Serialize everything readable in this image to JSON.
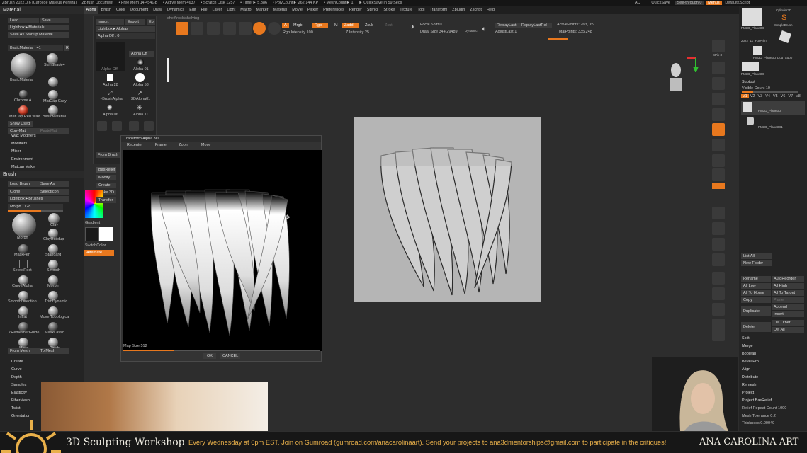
{
  "titlebar": {
    "items": [
      "ZBrush 2022.0.6 [Carol de Mateus Pereira]",
      "ZBrush Document",
      "• Free Mem 14.454GB",
      "• Active Mem 4637",
      "• Scratch Disk 1257",
      "• Timer► 5.386",
      "• PolyCount► 262.144 KP",
      "• MeshCount► 1",
      "► QuickSave In 59 Secs"
    ],
    "right": [
      "AC",
      "QuickSave",
      "See-through  0",
      "Menus",
      "DefaultZScript"
    ]
  },
  "menubar": [
    "Alpha",
    "Brush",
    "Color",
    "Document",
    "Draw",
    "Dynamics",
    "Edit",
    "File",
    "Layer",
    "Light",
    "Macro",
    "Marker",
    "Material",
    "Movie",
    "Picker",
    "Preferences",
    "Render",
    "Stencil",
    "Stroke",
    "Texture",
    "Tool",
    "Transform",
    "Zplugin",
    "Zscript",
    "Help"
  ],
  "left": {
    "material_title": "Material",
    "load": "Load",
    "save": "Save",
    "lightbox_materials": "Lightbox►Materials",
    "save_startup": "Save As Startup Material",
    "basic_material": "BasicMaterial . 41",
    "r": "R",
    "materials": [
      "BasicMaterial",
      "SkinShade4",
      "Chrome A",
      "MatCap Gray",
      "MatCap Red Wax",
      "BasicMaterial"
    ],
    "show_used": "Show Used",
    "copy_mat": "CopyMat",
    "paste_mat": "PasteMat",
    "sections": [
      "Wax Modifiers",
      "Modifiers",
      "Mixer",
      "Environment",
      "Matcap Maker"
    ],
    "brush_title": "Brush",
    "load_brush": "Load Brush",
    "save_as": "Save As",
    "clone": "Clone",
    "select_icon": "SelectIcon",
    "lightbox_brushes": "Lightbox►Brushes",
    "morph": "Morph . 128",
    "brushes": [
      "Morph",
      "Clay",
      "ClayBuildup",
      "MaskPen",
      "Standard",
      "SelectRect",
      "Smooth",
      "CurveAlpha",
      "Morph",
      "SmoothDirection",
      "TrimDynamic",
      "Inflat",
      "Move Topologica",
      "ZRemesherGuide",
      "MaskLasso",
      "Move",
      "Pinch"
    ],
    "from_mesh": "From Mesh",
    "to_mesh": "To Mesh",
    "bottom": [
      "Create",
      "Curve",
      "Depth",
      "Samples",
      "Elasticity",
      "FiberMesh",
      "Twist",
      "Orientation"
    ]
  },
  "alpha_menu": {
    "import": "Import",
    "export": "Export",
    "ep": "Ep",
    "lightbox_alphas": "Lightbox►Alphas",
    "alpha_off": "Alpha Off . 0",
    "alpha_off_btn": "Alpha Off",
    "items": [
      "Alpha Off",
      "Alpha 01",
      "Alpha 28",
      "Alpha 58",
      "~BrushAlpha",
      "3DAlpha01",
      "Alpha 06",
      "Alpha 11"
    ],
    "from_brush": "From Brush"
  },
  "modal": {
    "title": "Transform Alpha 3D",
    "tabs": [
      "Recenter",
      "Frame",
      "Zoom",
      "Move"
    ],
    "map_size": "Map Size 512",
    "map_size_value": 0.3,
    "ok": "OK",
    "cancel": "CANCEL"
  },
  "mid": {
    "bas_relief": "BasRelief",
    "modify": "Modify",
    "create": "Create",
    "make3d": "Make 3D",
    "transfer": "Transfer",
    "gradient": "Gradient",
    "switch_color": "SwitchColor",
    "alternate": "Alternate",
    "shelf": "shelf\\rock\\shelving"
  },
  "toolbar": {
    "a": "A",
    "mrgb": "Mrgb",
    "rgb": "Rgb",
    "m": "M",
    "zadd": "Zadd",
    "zsub": "Zsub",
    "zcut": "Zcut",
    "rgb_intensity": "Rgb Intensity 100",
    "z_intensity": "Z Intensity 25",
    "focal_shift": "Focal Shift 0",
    "draw_size": "Draw Size 344.29489",
    "dynamic": "Dynamic",
    "replay_last": "ReplayLast",
    "replay_last_rel": "ReplayLastRel",
    "adjust_last": "AdjustLast 1",
    "active_points": "ActivePoints: 263,169",
    "total_points": "TotalPoints: 335,248",
    "icons": [
      "Edit",
      "Draw",
      "Move",
      "Scale",
      "Rotate"
    ]
  },
  "right_shelf": [
    "SPix 3",
    "Scroll",
    "Zoom",
    "Actual",
    "AAHalf",
    "Persp",
    "Floor",
    "L.Sym",
    "Xyz",
    "Frame",
    "Move",
    "Zoom3D",
    "Rotate",
    "Line Fill",
    "PolyF",
    "Transp",
    "Ghost",
    "Solo",
    "Xpose"
  ],
  "right_tray": {
    "thumbs": [
      "PM3D_Plane3D",
      "Cylinder3D",
      "2022_11_FurPrim",
      "SimpleBrush",
      "PM3D_Plane3D",
      "PM3D_Plane3D",
      "Dog_Sub0"
    ],
    "subtool": "Subtool",
    "visible_count": "Visible Count 10",
    "tabs": [
      "V1",
      "V2",
      "V3",
      "V4",
      "V5",
      "V6",
      "V7",
      "V8"
    ],
    "subtools": [
      "PM3D_Plane3D",
      "PM3D_Plane3D1"
    ],
    "list_all": "List All",
    "new_folder": "New Folder",
    "buttons": [
      "Rename",
      "AutoReorder",
      "All Low",
      "All High",
      "All To Home",
      "All To Target",
      "Copy",
      "Paste",
      "Duplicate",
      "Append",
      "Insert",
      "Delete",
      "Del Other",
      "Del All"
    ],
    "items": [
      "Split",
      "Merge",
      "Boolean",
      "Bevel Pro",
      "Align",
      "Distribute",
      "Remesh",
      "Project",
      "Project BasRelief",
      "Relief Repeat Count 1000",
      "Mesh Tolerance 0.2",
      "Thickness 0.00049"
    ]
  },
  "banner": {
    "title": "3D Sculpting Workshop",
    "text": "Every Wednesday at 6pm EST. Join on Gumroad (gumroad.com/anacarolinaart). Send your projects to ana3dmentorships@gmail.com to participate in the critiques!",
    "brand": "ANA CAROLINA ART"
  },
  "colors": {
    "accent": "#e8781e",
    "banner_text": "#e9b04a",
    "canvas": "#b5b5b5"
  }
}
